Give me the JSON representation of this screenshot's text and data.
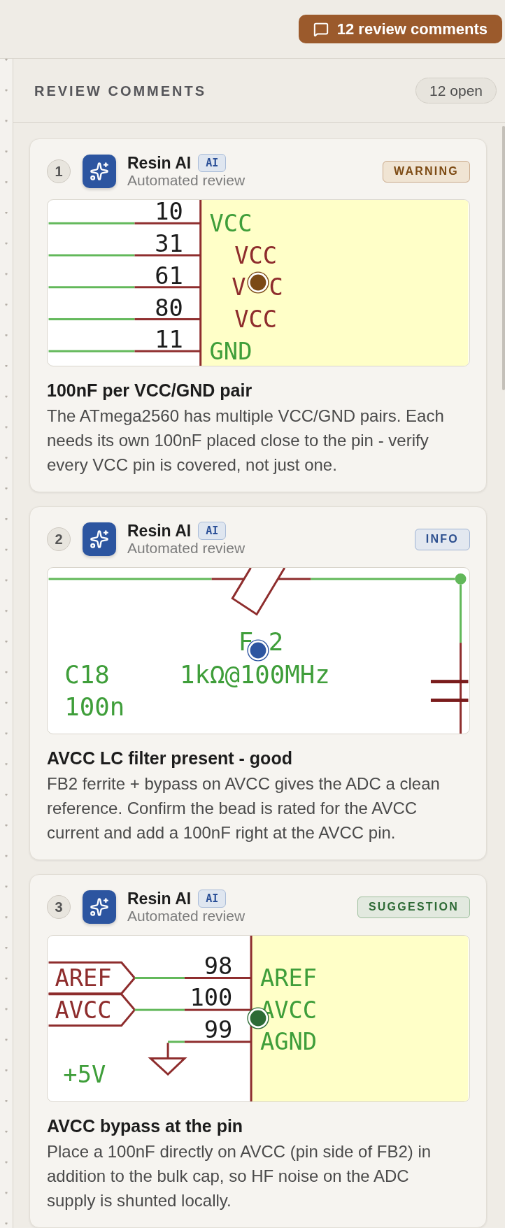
{
  "toolbar": {
    "comments_button": {
      "label": "12 review comments"
    }
  },
  "panel": {
    "title": "REVIEW COMMENTS",
    "count": "12 open"
  },
  "comments": [
    {
      "number": "1",
      "author": "Resin AI",
      "author_badge": "AI",
      "subtitle": "Automated review",
      "severity": {
        "label": "WARNING",
        "kind": "warning"
      },
      "snippet": {
        "kind": "ic_pins",
        "pins": [
          {
            "number": "10",
            "name": "VCC",
            "kind": "net"
          },
          {
            "number": "31",
            "name": "VCC",
            "kind": "pin"
          },
          {
            "number": "61",
            "name_parts": [
              "V",
              "C"
            ],
            "kind": "pin"
          },
          {
            "number": "80",
            "name": "VCC",
            "kind": "pin"
          },
          {
            "number": "11",
            "name": "GND",
            "kind": "net"
          }
        ]
      },
      "title": "100nF per VCC/GND pair",
      "body": "The ATmega2560 has multiple VCC/GND pairs. Each needs its own 100nF placed close to the pin - verify every VCC pin is covered, not just one."
    },
    {
      "number": "2",
      "author": "Resin AI",
      "author_badge": "AI",
      "subtitle": "Automated review",
      "severity": {
        "label": "INFO",
        "kind": "info"
      },
      "snippet": {
        "kind": "ferrite_filter",
        "bead_ref_parts": [
          "F",
          "2"
        ],
        "bead_value": "1kΩ@100MHz",
        "cap_ref": "C18",
        "cap_value": "100n"
      },
      "title": "AVCC LC filter present - good",
      "body": "FB2 ferrite + bypass on AVCC gives the ADC a clean reference. Confirm the bead is rated for the AVCC current and add a 100nF right at the AVCC pin."
    },
    {
      "number": "3",
      "author": "Resin AI",
      "author_badge": "AI",
      "subtitle": "Automated review",
      "severity": {
        "label": "SUGGESTION",
        "kind": "suggestion"
      },
      "snippet": {
        "kind": "analog_pins",
        "labels": [
          "AREF",
          "AVCC"
        ],
        "pins": [
          {
            "number": "98",
            "name": "AREF",
            "kind": "net"
          },
          {
            "number": "100",
            "name": "AVCC",
            "kind": "net"
          },
          {
            "number": "99",
            "name": "AGND",
            "kind": "net"
          }
        ],
        "power_label": "+5V"
      },
      "title": "AVCC bypass at the pin",
      "body": "Place a 100nF directly on AVCC (pin side of FB2) in addition to the bulk cap, so HF noise on the ADC supply is shunted locally."
    }
  ]
}
